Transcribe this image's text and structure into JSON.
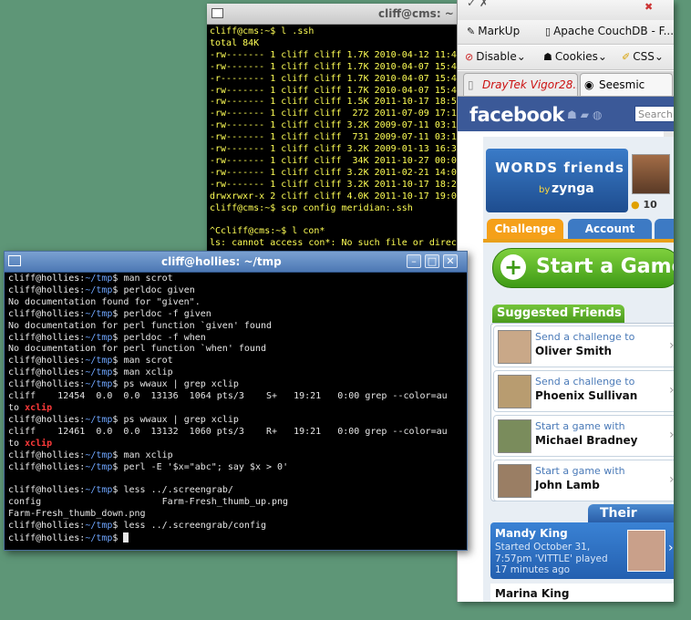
{
  "back_terminal": {
    "title": "cliff@cms: ~",
    "lines": [
      "cliff@cms:~$ l .ssh",
      "total 84K",
      "-rw------- 1 cliff cliff 1.7K 2010-04-12 11:4",
      "-rw------- 1 cliff cliff 1.7K 2010-04-07 15:4",
      "-r-------- 1 cliff cliff 1.7K 2010-04-07 15:4",
      "-rw------- 1 cliff cliff 1.7K 2010-04-07 15:4",
      "-rw------- 1 cliff cliff 1.5K 2011-10-17 18:5",
      "-rw------- 1 cliff cliff  272 2011-07-09 17:1",
      "-rw------- 1 cliff cliff 3.2K 2009-07-11 03:1",
      "-rw------- 1 cliff cliff  731 2009-07-11 03:1",
      "-rw------- 1 cliff cliff 3.2K 2009-01-13 16:3",
      "-rw------- 1 cliff cliff  34K 2011-10-27 00:0",
      "-rw------- 1 cliff cliff 3.2K 2011-02-21 14:0",
      "-rw------- 1 cliff cliff 3.2K 2011-10-17 18:2",
      "drwxrwxr-x 2 cliff cliff 4.0K 2011-10-17 19:0",
      "cliff@cms:~$ scp config meridian:.ssh",
      "",
      "^Ccliff@cms:~$ l con*",
      "ls: cannot access con*: No such file or direc"
    ]
  },
  "browser": {
    "bookmarks_row1": [
      {
        "icon": "✎",
        "label": "MarkUp"
      },
      {
        "icon": "▯",
        "label": "Apache CouchDB - F..."
      }
    ],
    "bookmarks_row2": [
      {
        "icon": "⊘",
        "label": "Disable"
      },
      {
        "icon": "☗",
        "label": "Cookies"
      },
      {
        "icon": "✐",
        "label": "CSS"
      }
    ],
    "tabs": [
      {
        "label": "DrayTek Vigor28..."
      },
      {
        "label": "Seesmic"
      }
    ],
    "facebook": {
      "logo": "facebook",
      "search_placeholder": "Search"
    },
    "app": {
      "wwf_title": "WORDS friends",
      "wwf_by": "by",
      "wwf_zynga": "zynga",
      "coins": "10",
      "tabs": [
        {
          "label": "Challenge",
          "color": "#f5a019"
        },
        {
          "label": "Account",
          "color": "#3d7ac4"
        }
      ],
      "start_button": "Start a Game",
      "suggested_header": "Suggested Friends",
      "suggested": [
        {
          "action": "Send a challenge to",
          "name": "Oliver Smith"
        },
        {
          "action": "Send a challenge to",
          "name": "Phoenix Sullivan"
        },
        {
          "action": "Start a game with",
          "name": "Michael Bradney"
        },
        {
          "action": "Start a game with",
          "name": "John Lamb"
        }
      ],
      "their_move_header": "Their Move",
      "moves": [
        {
          "name": "Mandy King",
          "detail": "Started October 31, 7:57pm 'VITTLE' played 17 minutes ago"
        },
        {
          "name": "Marina King"
        }
      ]
    }
  },
  "front_terminal": {
    "title": "cliff@hollies: ~/tmp",
    "prompt_user": "cliff@hollies",
    "prompt_path": "~/tmp",
    "lines": [
      {
        "type": "cmd",
        "text": " man scrot"
      },
      {
        "type": "cmd",
        "text": " perldoc given"
      },
      {
        "type": "out",
        "text": "No documentation found for \"given\"."
      },
      {
        "type": "cmd",
        "text": " perldoc -f given"
      },
      {
        "type": "out",
        "text": "No documentation for perl function `given' found"
      },
      {
        "type": "cmd",
        "text": " perldoc -f when"
      },
      {
        "type": "out",
        "text": "No documentation for perl function `when' found"
      },
      {
        "type": "cmd",
        "text": " man scrot"
      },
      {
        "type": "cmd",
        "text": " man xclip"
      },
      {
        "type": "cmd",
        "text": " ps wwaux | grep xclip"
      },
      {
        "type": "out",
        "text": "cliff    12454  0.0  0.0  13136  1064 pts/3    S+   19:21   0:00 grep --color=au"
      },
      {
        "type": "hl",
        "pre": "to ",
        "hl": "xclip"
      },
      {
        "type": "cmd",
        "text": " ps wwaux | grep xclip"
      },
      {
        "type": "out",
        "text": "cliff    12461  0.0  0.0  13132  1060 pts/3    R+   19:21   0:00 grep --color=au"
      },
      {
        "type": "hl",
        "pre": "to ",
        "hl": "xclip"
      },
      {
        "type": "cmd",
        "text": " man xclip"
      },
      {
        "type": "cmd",
        "text": " perl -E '$x=\"abc\"; say $x > 0'"
      },
      {
        "type": "out",
        "text": ""
      },
      {
        "type": "cmd",
        "text": " less ../.screengrab/"
      },
      {
        "type": "out",
        "text": "config                      Farm-Fresh_thumb_up.png"
      },
      {
        "type": "out",
        "text": "Farm-Fresh_thumb_down.png"
      },
      {
        "type": "cmd",
        "text": " less ../.screengrab/config"
      },
      {
        "type": "prompt",
        "text": " "
      }
    ]
  }
}
